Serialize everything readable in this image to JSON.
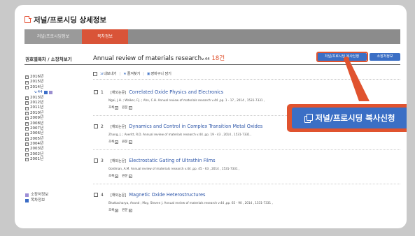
{
  "page": {
    "title": "저널/프로시딩 상세정보"
  },
  "tabs": [
    {
      "label": "저널/프로시딩정보"
    },
    {
      "label": "목차정보"
    }
  ],
  "sidebar": {
    "title": "권호별목차 / 소장처보기",
    "years": [
      "2016년",
      "2015년",
      "2014년",
      "2013년",
      "2012년",
      "2011년",
      "2010년",
      "2009년",
      "2008년",
      "2007년",
      "2006년",
      "2005년",
      "2004년",
      "2003년",
      "2002년",
      "2001년"
    ],
    "expanded_year": "2014년",
    "volume": "v.44",
    "legend": [
      {
        "label": "소장처정보",
        "color": "#9d8ed6"
      },
      {
        "label": "목차정보",
        "color": "#3b6cc5"
      }
    ]
  },
  "main": {
    "journal_title": "Annual review of materials research",
    "volume": "v.44",
    "count": "18건",
    "copy_request_button": "저널/프로시딩 복사신청",
    "holding_button": "소장처정보",
    "actions": {
      "export": "내보내기",
      "favorite": "즐겨찾기",
      "cart": "장바구니 담기"
    },
    "records": [
      {
        "num": "1",
        "type": "[해외논문]",
        "title": "Correlated Oxide Physics and Electronics",
        "cite": "Ngai, J.H. ; Walker, F.J. ; Ahn, C.H. Annual review of materials research v.44 ,pp. 1 - 17 , 2014 , 1531-7331 ,",
        "links": [
          "초록",
          "원문"
        ]
      },
      {
        "num": "2",
        "type": "[해외논문]",
        "title": "Dynamics and Control in Complex Transition Metal Oxides",
        "cite": "Zhang, J. ; Averitt, R.D. Annual review of materials research v.44 ,pp. 19 - 43 , 2014 , 1531-7331 ,",
        "links": [
          "초록",
          "원문"
        ]
      },
      {
        "num": "3",
        "type": "[해외논문]",
        "title": "Electrostatic Gating of Ultrathin Films",
        "cite": "Goldman, A.M. Annual review of materials research v.44 ,pp. 45 - 63 , 2014 , 1531-7331 ,",
        "links": [
          "초록",
          "원문"
        ]
      },
      {
        "num": "4",
        "type": "[해외논문]",
        "title": "Magnetic Oxide Heterostructures",
        "cite": "Bhattacharya, Anand ; May, Steven J. Annual review of materials research v.44 ,pp. 65 - 90 , 2014 , 1531-7331 ,",
        "links": [
          "초록",
          "원문"
        ]
      }
    ]
  },
  "callout": {
    "label": "저널/프로시딩 복사신청"
  },
  "colors": {
    "accent": "#e0532f",
    "primary_blue": "#3b6fc5",
    "tab_gray": "#8c8c8c"
  }
}
